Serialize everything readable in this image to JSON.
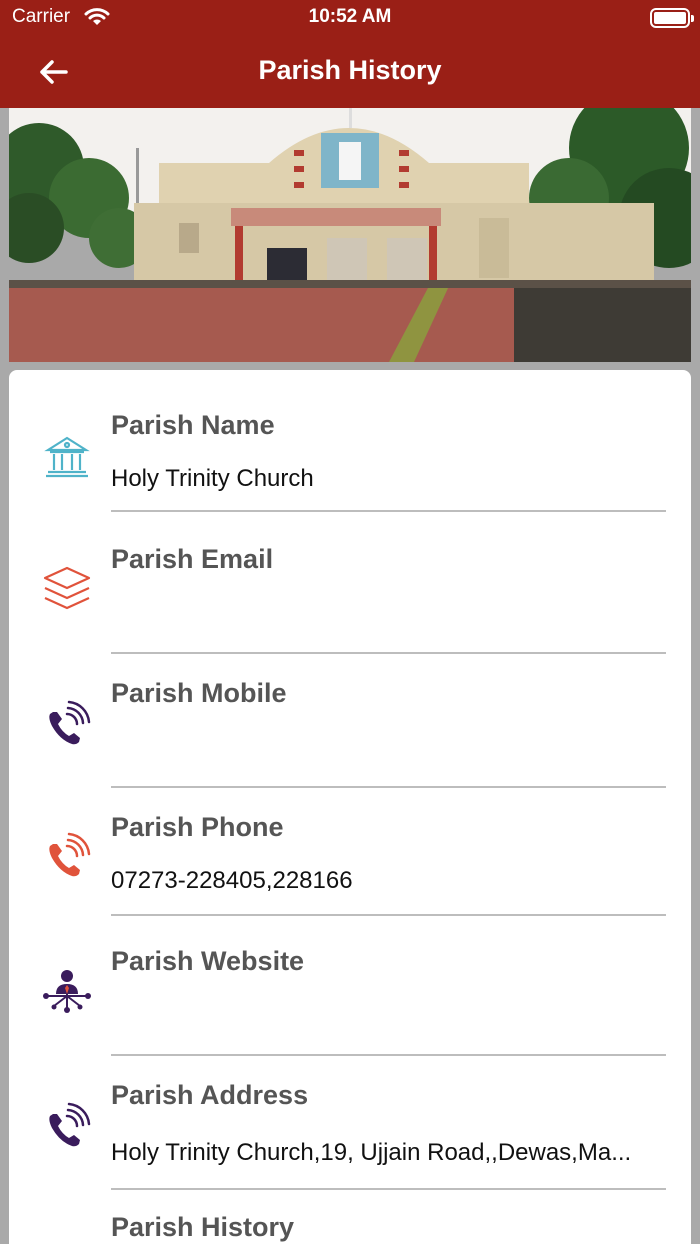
{
  "status_bar": {
    "carrier": "Carrier",
    "time": "10:52 AM"
  },
  "header": {
    "title": "Parish History"
  },
  "fields": [
    {
      "label": "Parish Name",
      "value": "Holy Trinity Church"
    },
    {
      "label": "Parish Email",
      "value": ""
    },
    {
      "label": "Parish Mobile",
      "value": ""
    },
    {
      "label": "Parish Phone",
      "value": "07273-228405,228166"
    },
    {
      "label": "Parish Website",
      "value": ""
    },
    {
      "label": "Parish Address",
      "value": "Holy Trinity Church,19, Ujjain Road,,Dewas,Ma..."
    },
    {
      "label": "Parish History",
      "value": ""
    }
  ],
  "colors": {
    "header_bg": "#9a1f16",
    "icon_teal": "#4fb3c9",
    "icon_orange": "#e0533b",
    "icon_purple": "#3a1c5c"
  },
  "icons": [
    "church-icon",
    "layers-icon",
    "phone-signal-icon",
    "phone-signal-icon",
    "network-icon",
    "phone-signal-icon"
  ]
}
